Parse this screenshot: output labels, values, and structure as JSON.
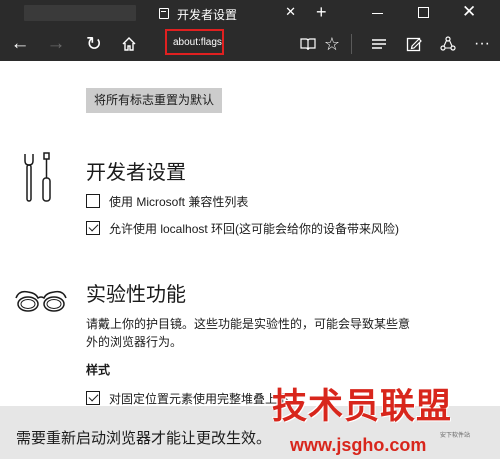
{
  "tab": {
    "title": "开发者设置",
    "close": "✕",
    "new": "+"
  },
  "window": {
    "close": "✕"
  },
  "nav": {
    "back": "←",
    "forward": "→",
    "refresh": "↻",
    "address": "about:flags",
    "favorite": "☆",
    "more": "···"
  },
  "content": {
    "reset_button": "将所有标志重置为默认",
    "developer": {
      "title": "开发者设置",
      "options": [
        {
          "label": "使用 Microsoft 兼容性列表",
          "checked": false
        },
        {
          "label": "允许使用 localhost 环回(这可能会给你的设备带来风险)",
          "checked": true
        }
      ]
    },
    "experimental": {
      "title": "实验性功能",
      "description": "请戴上你的护目镜。这些功能是实验性的，可能会导致某些意外的浏览器行为。",
      "style_heading": "样式",
      "options": [
        {
          "label": "对固定位置元素使用完整堆叠上下文",
          "checked": true
        }
      ]
    }
  },
  "notification": {
    "text": "需要重新启动浏览器才能让更改生效。"
  },
  "watermark": {
    "title": "技术员联盟",
    "url": "www.jsgho.com",
    "small": "安下软件站"
  }
}
